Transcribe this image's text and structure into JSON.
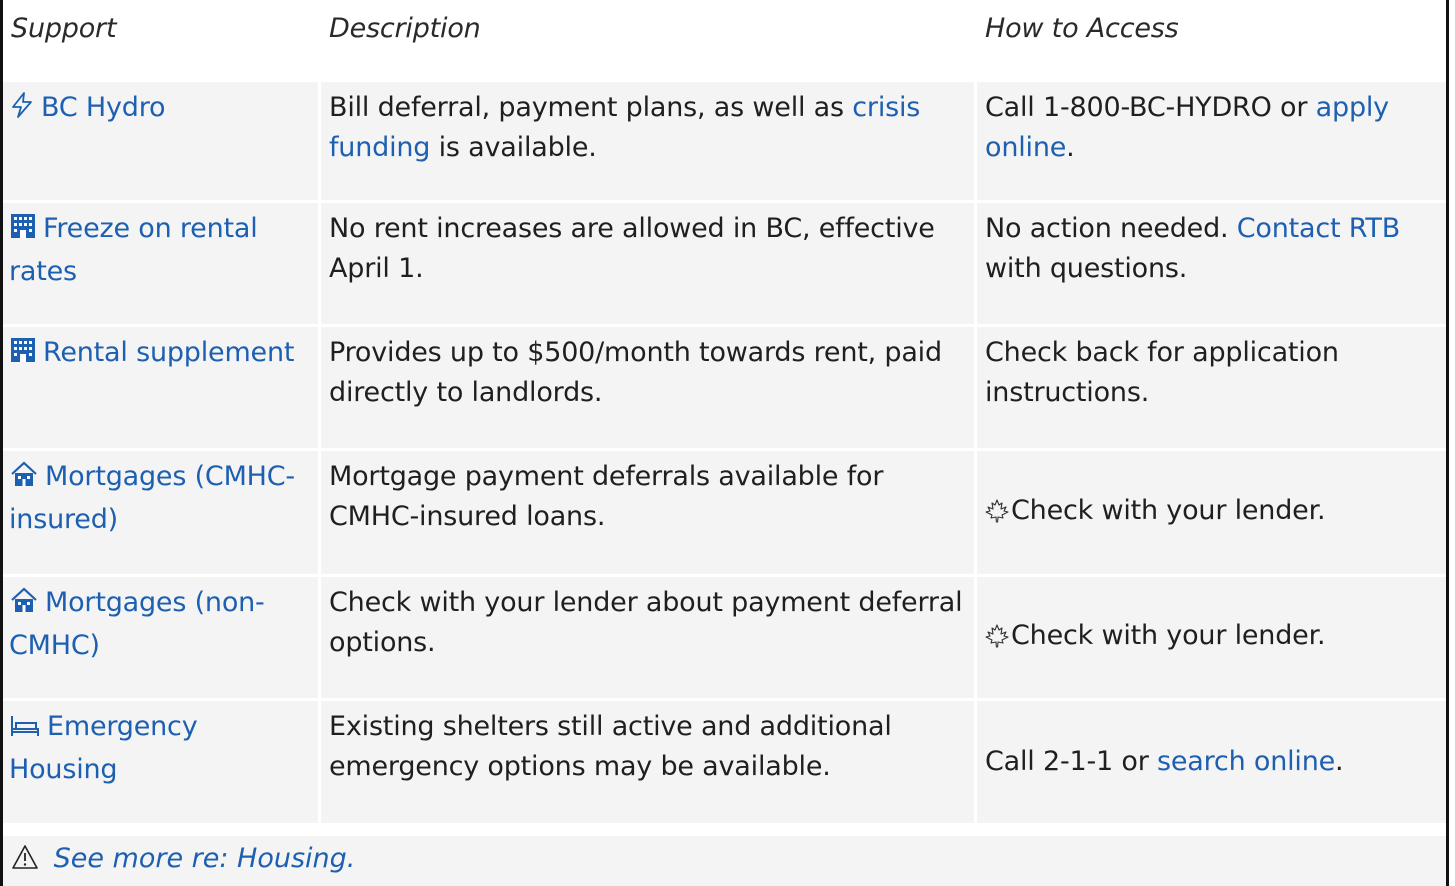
{
  "table": {
    "headers": [
      "Support",
      "Description",
      "How to Access"
    ],
    "rows": [
      {
        "icon": "lightning-icon",
        "support": "BC Hydro",
        "description": {
          "pre": "Bill deferral, payment plans, as well as ",
          "link": "crisis funding",
          "post": " is available."
        },
        "access": {
          "pre": "Call 1-800-BC-HYDRO or ",
          "link": "apply online",
          "post": "."
        }
      },
      {
        "icon": "building-icon",
        "support": "Freeze on rental rates",
        "description": {
          "pre": "No rent increases are allowed in BC, effective April 1.",
          "link": "",
          "post": ""
        },
        "access": {
          "pre": "No action needed. ",
          "link": "Contact RTB",
          "post": " with questions."
        }
      },
      {
        "icon": "building-icon",
        "support": "Rental supplement",
        "description": {
          "pre": "Provides up to $500/month towards rent, paid directly to landlords.",
          "link": "",
          "post": ""
        },
        "access": {
          "pre": "Check back for application instructions.",
          "link": "",
          "post": ""
        }
      },
      {
        "icon": "house-icon",
        "support": "Mortgages (CMHC-insured)",
        "description": {
          "pre": "Mortgage payment deferrals available for CMHC-insured loans.",
          "link": "",
          "post": ""
        },
        "access": {
          "icon": "maple-leaf-icon",
          "pre": "Check with your lender.",
          "link": "",
          "post": ""
        }
      },
      {
        "icon": "house-icon",
        "support": "Mortgages (non-CMHC)",
        "description": {
          "pre": "Check with your lender about payment deferral options.",
          "link": "",
          "post": ""
        },
        "access": {
          "icon": "maple-leaf-icon",
          "pre": "Check with your lender.",
          "link": "",
          "post": ""
        }
      },
      {
        "icon": "bed-icon",
        "support": "Emergency Housing",
        "description": {
          "pre": "Existing shelters still active and additional emergency options may be available.",
          "link": "",
          "post": ""
        },
        "access": {
          "pre": "Call 2-1-1  or ",
          "link": "search online",
          "post": "."
        }
      }
    ]
  },
  "footer": {
    "icon": "warning-icon",
    "text": "See more re: Housing."
  },
  "colors": {
    "link": "#1d5fb0",
    "row_bg": "#f4f4f4",
    "border": "#111111"
  }
}
